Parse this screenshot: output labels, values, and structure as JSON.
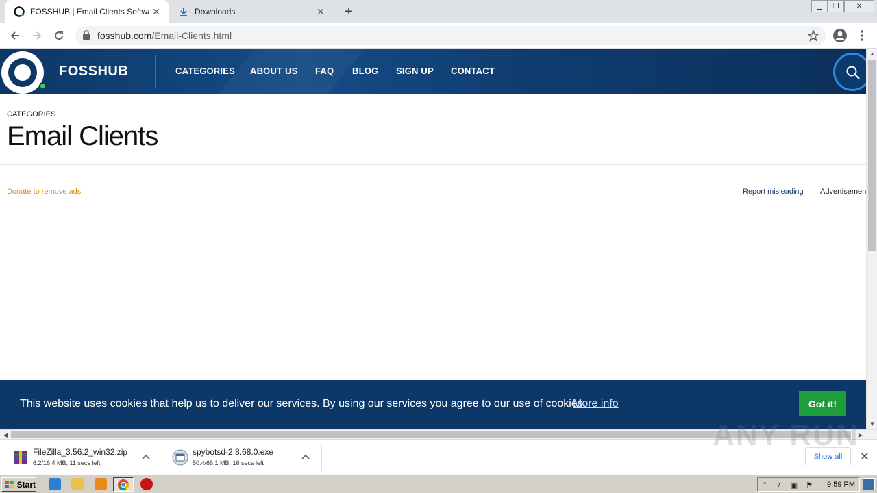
{
  "browser": {
    "tabs": [
      {
        "title": "FOSSHUB | Email Clients Software.",
        "active": true
      },
      {
        "title": "Downloads",
        "active": false
      }
    ],
    "url_domain": "fosshub.com",
    "url_path": "/Email-Clients.html"
  },
  "site": {
    "brand": "FOSSHUB",
    "nav": [
      "CATEGORIES",
      "ABOUT US",
      "FAQ",
      "BLOG",
      "SIGN UP",
      "CONTACT"
    ],
    "breadcrumb": "CATEGORIES",
    "title": "Email Clients",
    "donate": "Donate to remove ads",
    "report": "Report misleading",
    "advertisement": "Advertisement"
  },
  "cookie": {
    "message": "This website uses cookies that help us to deliver our services. By using our services you agree to our use of cookies.",
    "more": "More info",
    "button": "Got it!"
  },
  "downloads": [
    {
      "name": "FileZilla_3.56.2_win32.zip",
      "status": "6.2/16.4 MB, 11 secs left"
    },
    {
      "name": "spybotsd-2.8.68.0.exe",
      "status": "50.4/66.1 MB, 16 secs left"
    }
  ],
  "shelf": {
    "show_all": "Show all"
  },
  "watermark": "ANY RUN",
  "taskbar": {
    "start": "Start",
    "clock": "9:59 PM"
  },
  "colors": {
    "header": "#0c3766",
    "accent_green": "#1f9d3a",
    "donate": "#e08e00"
  }
}
